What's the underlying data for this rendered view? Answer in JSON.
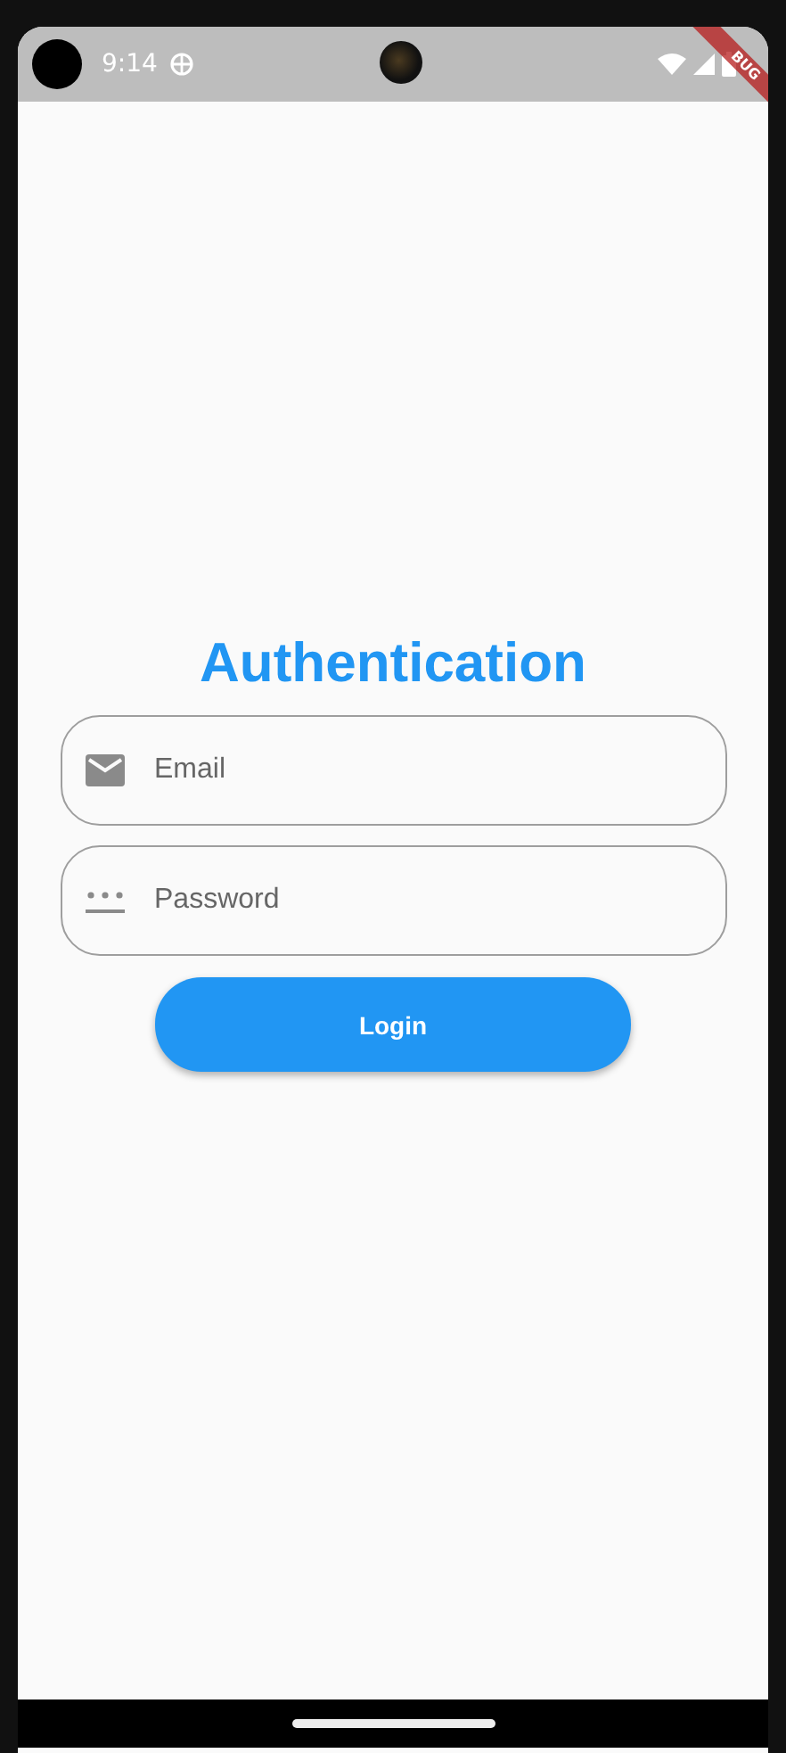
{
  "status_bar": {
    "time": "9:14"
  },
  "debug_banner": {
    "label": "BUG"
  },
  "title": "Authentication",
  "fields": [
    {
      "kind": "email",
      "placeholder": "Email"
    },
    {
      "kind": "password",
      "placeholder": "Password"
    }
  ],
  "login_button": {
    "label": "Login"
  }
}
